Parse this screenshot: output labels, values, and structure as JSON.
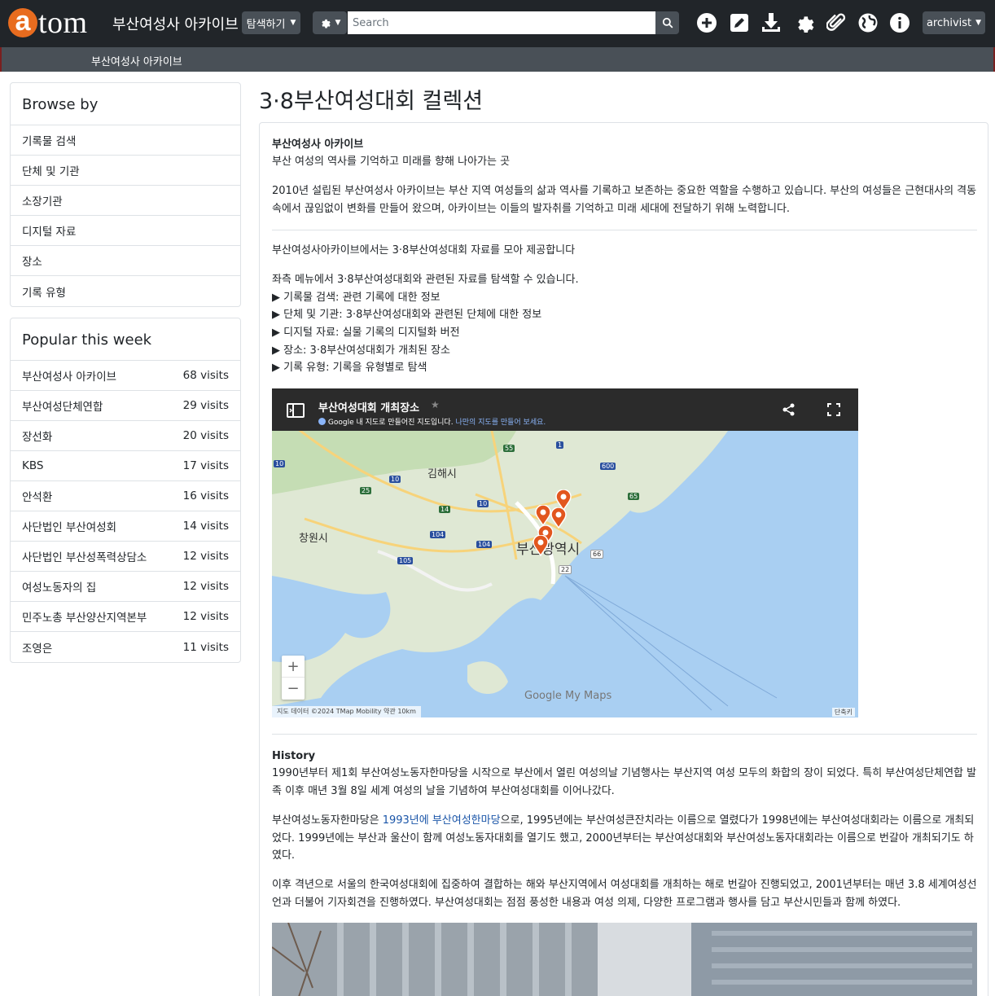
{
  "header": {
    "logo_letter": "a",
    "logo_rest": "tom",
    "site_title": "부산여성사 아카이브",
    "browse_label": "탐색하기",
    "search_placeholder": "Search",
    "user_label": "archivist"
  },
  "subbar": {
    "title": "부산여성사 아카이브"
  },
  "browse_by": {
    "title": "Browse by",
    "items": [
      "기록물 검색",
      "단체 및 기관",
      "소장기관",
      "디지털 자료",
      "장소",
      "기록 유형"
    ]
  },
  "popular": {
    "title": "Popular this week",
    "items": [
      {
        "name": "부산여성사 아카이브",
        "visits": "68 visits"
      },
      {
        "name": "부산여성단체연합",
        "visits": "29 visits"
      },
      {
        "name": "장선화",
        "visits": "20 visits"
      },
      {
        "name": "KBS",
        "visits": "17 visits"
      },
      {
        "name": "안석환",
        "visits": "16 visits"
      },
      {
        "name": "사단법인 부산여성회",
        "visits": "14 visits"
      },
      {
        "name": "사단법인 부산성폭력상담소",
        "visits": "12 visits"
      },
      {
        "name": "여성노동자의 집",
        "visits": "12 visits"
      },
      {
        "name": "민주노총 부산양산지역본부",
        "visits": "12 visits"
      },
      {
        "name": "조영은",
        "visits": "11 visits"
      }
    ]
  },
  "main": {
    "page_title": "3·8부산여성대회 컬렉션",
    "intro_heading": "부산여성사 아카이브",
    "intro_tagline": "부산 여성의 역사를 기억하고 미래를 향해 나아가는 곳",
    "intro_body": "2010년 설립된 부산여성사 아카이브는 부산 지역 여성들의 삶과 역사를 기록하고 보존하는 중요한 역할을 수행하고 있습니다. 부산의 여성들은 근현대사의 격동 속에서 끊임없이 변화를 만들어 왔으며, 아카이브는 이들의 발자취를 기억하고 미래 세대에 전달하기 위해 노력합니다.",
    "collect_line": "부산여성사아카이브에서는 3·8부산여성대회 자료를 모아 제공합니다",
    "menu_intro": "좌측 메뉴에서 3·8부산여성대회와 관련된 자료를 탐색할 수 있습니다.",
    "menu_items": [
      "▶ 기록물 검색: 관련 기록에 대한 정보",
      "▶ 단체 및 기관: 3·8부산여성대회와 관련된 단체에 대한 정보",
      "▶ 디지털 자료: 실물 기록의 디지털화 버전",
      "▶ 장소: 3·8부산여성대회가 개최된 장소",
      "▶ 기록 유형: 기록을 유형별로 탐색"
    ],
    "history_heading": "History",
    "history_p1": "1990년부터 제1회 부산여성노동자한마당을 시작으로 부산에서 열린 여성의날 기념행사는 부산지역 여성 모두의 화합의 장이 되었다. 특히 부산여성단체연합 발족 이후 매년 3월 8일 세계 여성의 날을 기념하여 부산여성대회를 이어나갔다.",
    "history_p2_pre": "부산여성노동자한마당은 ",
    "history_p2_link": "1993년에 부산여성한마당",
    "history_p2_post": "으로, 1995년에는 부산여성큰잔치라는 이름으로 열렸다가 1998년에는 부산여성대회라는 이름으로 개최되었다. 1999년에는 부산과 울산이 함께 여성노동자대회를 열기도 했고, 2000년부터는 부산여성대회와 부산여성노동자대회라는 이름으로 번갈아 개최되기도 하였다.",
    "history_p3": "이후 격년으로 서울의 한국여성대회에 집중하여 결합하는 해와 부산지역에서 여성대회를 개최하는 해로 번갈아 진행되었고, 2001년부터는 매년 3.8 세계여성선언과 더불어 기자회견을 진행하였다. 부산여성대회는 점점 풍성한 내용과 여성 의제, 다양한 프로그램과 행사를 담고 부산시민들과 함께 하였다."
  },
  "map": {
    "title": "부산여성대회 개최장소",
    "sub_pre": "Google 내 지도로 만들어진 지도입니다.",
    "sub_link": "나만의 지도를 만들어 보세요.",
    "label_gimhae": "김해시",
    "label_changwon": "창원시",
    "label_busan": "부산광역시",
    "road_numbers": [
      "55",
      "1",
      "10",
      "600",
      "25",
      "10",
      "10",
      "65",
      "14",
      "104",
      "104",
      "105",
      "66",
      "22"
    ],
    "footer": "지도 데이터 ©2024 TMap Mobility   약관   10km",
    "shortcut": "단축키",
    "branding": "Google My Maps",
    "zoom_in": "+",
    "zoom_out": "−"
  }
}
